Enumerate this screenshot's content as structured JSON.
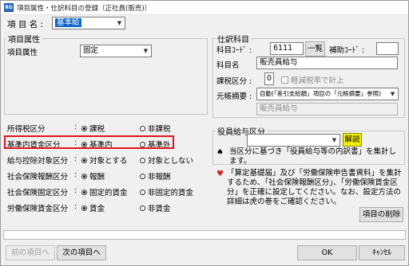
{
  "window": {
    "title": "項目属性・仕訳科目の登録（正社員(販売)）",
    "app_icon_text": "RG"
  },
  "header": {
    "item_name_label": "項 目 名 :",
    "item_name_value": "基本給"
  },
  "attributes": {
    "group_title": "項目属性",
    "item_attr_label": "項目属性",
    "item_attr_value": "固定"
  },
  "journal": {
    "group_title": "仕訳科目",
    "account_code_label": "科目ｺｰﾄﾞ :",
    "account_code_value": "6111",
    "list_button": "一覧",
    "sub_code_label": "補助ｺｰﾄﾞ :",
    "sub_code_value": "",
    "account_name_label": "科目名",
    "account_name_value": "販売員給与",
    "tax_class_label": "課税区分 :",
    "tax_class_value": "0",
    "reduced_tax_label": "軽減税率で計上",
    "memo_label": "元帳摘要 :",
    "memo_value": "自動(「差引支給額」項目の「元帳摘要」参照)",
    "memo_text": "販売員給与"
  },
  "rows": [
    {
      "label": "所得税区分",
      "colon": ":",
      "options": [
        "課税",
        "非課税"
      ],
      "selected": 0
    },
    {
      "label": "基準内賃金区分",
      "colon": ":",
      "options": [
        "基準内",
        "基準外"
      ],
      "selected": 0
    },
    {
      "label": "給与控除対象区分",
      "colon": ":",
      "options": [
        "対象とする",
        "対象としない"
      ],
      "selected": 0
    },
    {
      "label": "社会保険報酬区分",
      "colon": ":",
      "options": [
        "報酬",
        "非報酬"
      ],
      "selected": 0
    },
    {
      "label": "社会保険固定区分",
      "colon": ":",
      "options": [
        "固定的賃金",
        "非固定的賃金"
      ],
      "selected": 0
    },
    {
      "label": "労働保険賃金区分",
      "colon": ":",
      "options": [
        "賃金",
        "非賃金"
      ],
      "selected": 0
    }
  ],
  "officer": {
    "group_title": "役員給与区分",
    "select_value": "",
    "explain_button": "解説",
    "note": "当区分に基づき「役員給与等の内訳書」を集計します。"
  },
  "notice": {
    "text": "「算定基礎届」及び「労働保険申告書資料」を集計するため、「社会保険報酬区分」、「労働保険賃金区分」を正確に設定してください。なお、設定方法の詳細は虎の巻をご確認ください。"
  },
  "buttons": {
    "delete_item": "項目の削除",
    "prev_item": "前の項目へ",
    "next_item": "次の項目へ",
    "ok": "OK",
    "cancel": "ｷｬﾝｾﾙ"
  },
  "colors": {
    "highlight": "#e0141e",
    "selection": "#0a64c8",
    "heart": "#d42020",
    "explain_button_bg": "#f5f000"
  }
}
